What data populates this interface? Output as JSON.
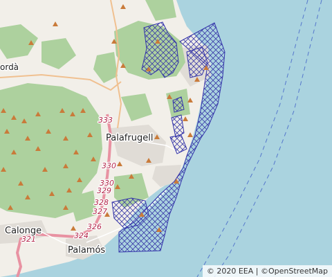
{
  "map": {
    "places": [
      {
        "name": "Palafrugell",
        "key": "palafrugell"
      },
      {
        "name": "Calonge",
        "key": "calonge"
      },
      {
        "name": "Palamós",
        "key": "palamos"
      },
      {
        "name": "ordà",
        "key": "torroella-partial"
      }
    ],
    "road_km_markers": [
      "333",
      "330",
      "330",
      "329",
      "328",
      "327",
      "326",
      "324",
      "321"
    ],
    "colors": {
      "sea": "#aad3df",
      "land": "#f2efe9",
      "forest": "#add19e",
      "protected_area_outline": "#3333aa",
      "road": "#e892a2",
      "peak_marker": "#c97b3a"
    }
  },
  "attribution": {
    "copyright_symbol_1": "©",
    "eea": "2020 EEA",
    "separator": "|",
    "copyright_symbol_2": "©",
    "osm": "OpenStreetMap"
  }
}
